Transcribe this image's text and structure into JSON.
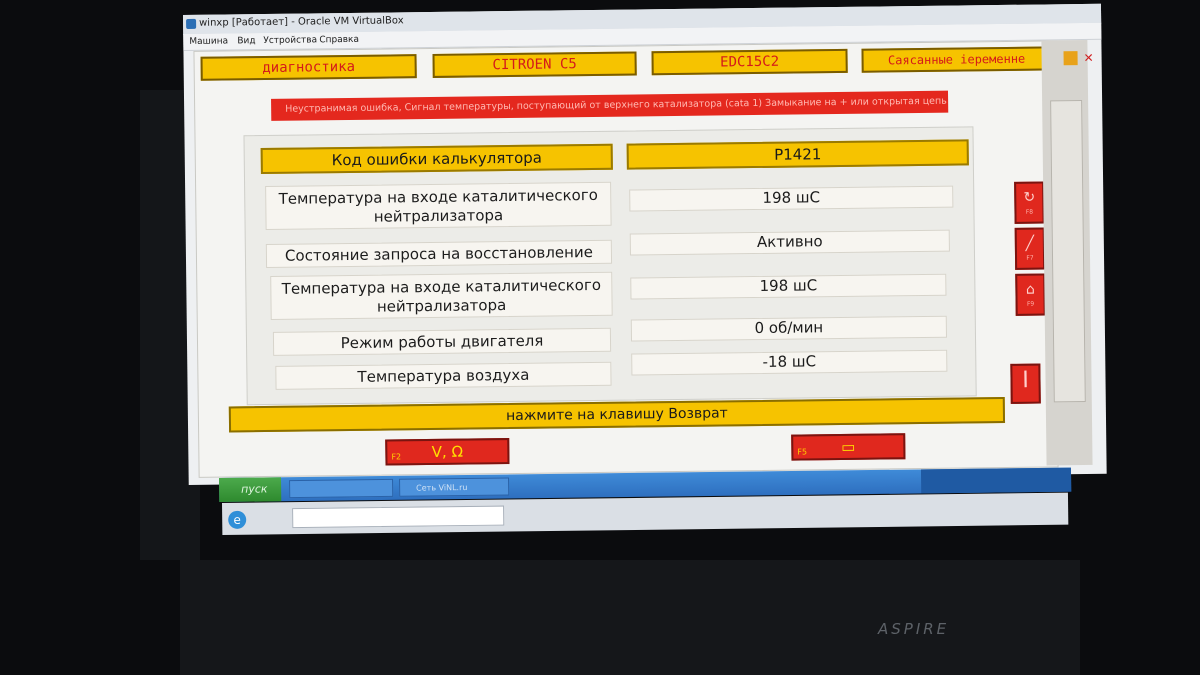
{
  "host": {
    "title": "winxp [Работает] - Oracle VM VirtualBox",
    "menu": [
      "Машина",
      "Вид",
      "Устройства",
      "Справка"
    ]
  },
  "app": {
    "top_buttons": [
      "диагностика",
      "CITROEN C5",
      "EDC15C2",
      "Саясанные іеременне"
    ],
    "error_message": "Неустранимая ошибка, Сигнал температуры, поступающий от верхнего катализатора (cata 1)   Замыкание на + или открытая цепь",
    "header": {
      "label": "Код ошибки калькулятора",
      "value": "P1421"
    },
    "rows": [
      {
        "label": "Температура на входе каталитического нейтрализатора",
        "value": "198   шС"
      },
      {
        "label": "Состояние запроса на восстановление",
        "value": "Активно"
      },
      {
        "label": "Температура на входе каталитического нейтрализатора",
        "value": "198   шС"
      },
      {
        "label": "Режим работы двигателя",
        "value": "0      об/мин"
      },
      {
        "label": "Температура воздуха",
        "value": "-18   шС"
      }
    ],
    "prompt": "нажмите на клавишу Возврат",
    "fkeys": [
      {
        "key": "F2",
        "label": "V, Ω"
      },
      {
        "key": "F5",
        "label": ""
      }
    ],
    "side_buttons": [
      {
        "icon": "refresh-icon"
      },
      {
        "icon": "pencil-icon"
      },
      {
        "icon": "engine-icon"
      },
      {
        "icon": "exit-icon"
      }
    ]
  },
  "taskbar": {
    "start_label": "пуск",
    "items": [
      "",
      "Сеть ViNL.ru"
    ]
  },
  "colors": {
    "yellow": "#f6c300",
    "red": "#e0281e",
    "panel": "#ecece8"
  }
}
